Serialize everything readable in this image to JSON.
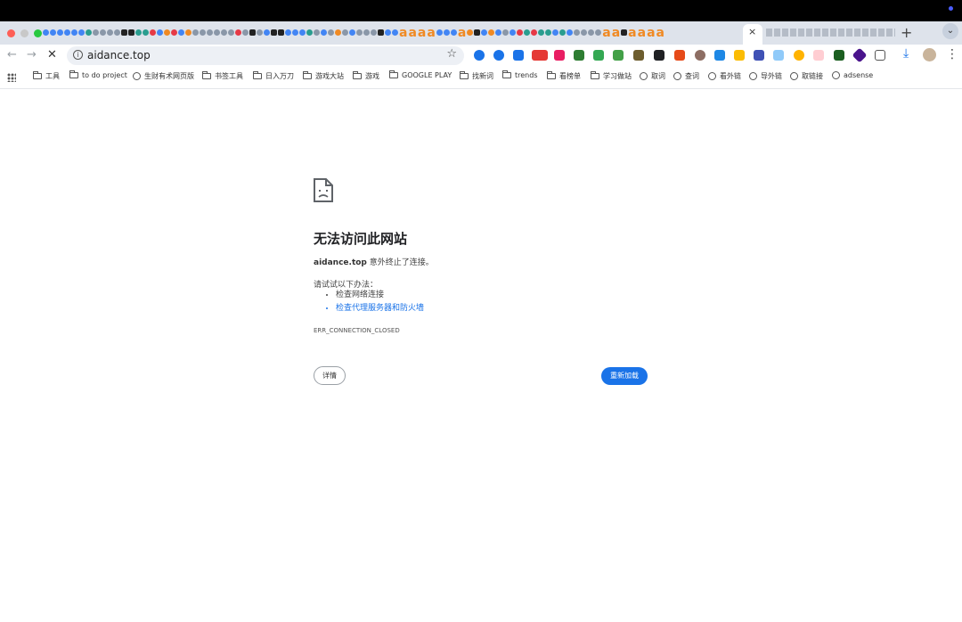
{
  "browser": {
    "tab_close": "×",
    "new_tab": "+",
    "tab_letters": [
      "a",
      "a",
      "a",
      "a",
      "a",
      "a",
      "a",
      "a",
      "a",
      "a",
      "a",
      "a"
    ]
  },
  "toolbar": {
    "url": "aidance.top"
  },
  "bookmarks": [
    {
      "label": "工具",
      "icon": "folder-icon"
    },
    {
      "label": "to do project",
      "icon": "folder-icon"
    },
    {
      "label": "生财有术网页版",
      "icon": "globe-icon"
    },
    {
      "label": "书签工具",
      "icon": "folder-icon"
    },
    {
      "label": "日入万刀",
      "icon": "folder-icon"
    },
    {
      "label": "游戏大站",
      "icon": "folder-icon"
    },
    {
      "label": "游戏",
      "icon": "folder-icon"
    },
    {
      "label": "GOOGLE PLAY",
      "icon": "folder-icon"
    },
    {
      "label": "找新词",
      "icon": "folder-icon"
    },
    {
      "label": "trends",
      "icon": "folder-icon"
    },
    {
      "label": "看榜单",
      "icon": "folder-icon"
    },
    {
      "label": "学习做站",
      "icon": "folder-icon"
    },
    {
      "label": "取词",
      "icon": "globe-icon"
    },
    {
      "label": "查词",
      "icon": "globe-icon"
    },
    {
      "label": "看外链",
      "icon": "globe-icon"
    },
    {
      "label": "导外链",
      "icon": "globe-icon"
    },
    {
      "label": "取链接",
      "icon": "globe-icon"
    },
    {
      "label": "adsense",
      "icon": "globe-icon"
    }
  ],
  "error": {
    "title": "无法访问此网站",
    "host": "aidance.top",
    "desc_suffix": " 意外终止了连接。",
    "try_label": "请试试以下办法：",
    "suggestions": [
      "检查网络连接",
      "检查代理服务器和防火墙"
    ],
    "code": "ERR_CONNECTION_CLOSED",
    "details_button": "详情",
    "reload_button": "重新加载"
  },
  "colors": {
    "accent": "#1a73e8",
    "tabstrip": "#dee3eb",
    "tab_letter": "#f08a24"
  }
}
